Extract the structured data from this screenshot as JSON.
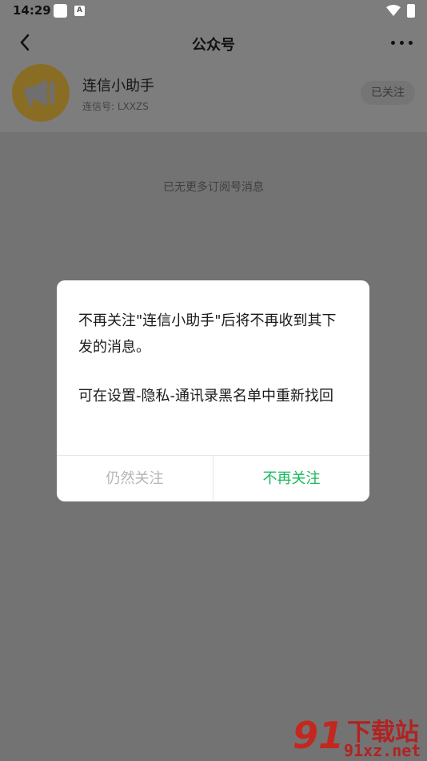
{
  "status_bar": {
    "time": "14:29",
    "a_badge": "A"
  },
  "nav": {
    "title": "公众号"
  },
  "account": {
    "name": "连信小助手",
    "id_text": "连信号: LXXZS",
    "follow_status": "已关注"
  },
  "feed": {
    "empty_text": "已无更多订阅号消息"
  },
  "dialog": {
    "message_line1": "不再关注\"连信小助手\"后将不再收到其下发的消息。",
    "message_line2": "可在设置-隐私-通讯录黑名单中重新找回",
    "keep_label": "仍然关注",
    "unfollow_label": "不再关注"
  },
  "watermark": {
    "logo": "91",
    "title": "下载站",
    "url": "91xz.net"
  },
  "colors": {
    "accent_green": "#17b85b",
    "avatar_gold": "#8a6d24",
    "overlay": "#7d7d7d"
  }
}
